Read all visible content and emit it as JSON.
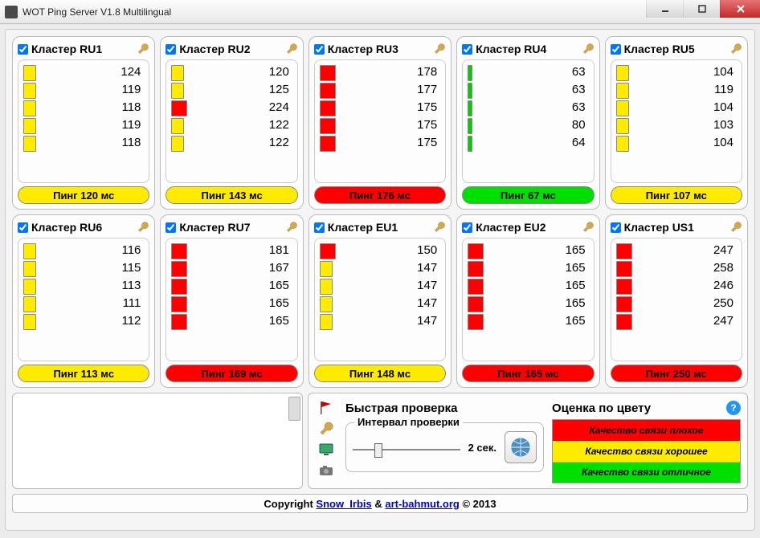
{
  "window": {
    "title": "WOT Ping Server V1.8 Multilingual"
  },
  "clusters": [
    {
      "name": "Кластер RU1",
      "checked": true,
      "pings": [
        124,
        119,
        118,
        119,
        118
      ],
      "levels": [
        "yellow",
        "yellow",
        "yellow",
        "yellow",
        "yellow"
      ],
      "summary": "Пинг 120 мс",
      "summary_level": "yellow"
    },
    {
      "name": "Кластер RU2",
      "checked": true,
      "pings": [
        120,
        125,
        224,
        122,
        122
      ],
      "levels": [
        "yellow",
        "yellow",
        "red",
        "yellow",
        "yellow"
      ],
      "summary": "Пинг 143 мс",
      "summary_level": "yellow"
    },
    {
      "name": "Кластер RU3",
      "checked": true,
      "pings": [
        178,
        177,
        175,
        175,
        175
      ],
      "levels": [
        "red",
        "red",
        "red",
        "red",
        "red"
      ],
      "summary": "Пинг 176 мс",
      "summary_level": "red"
    },
    {
      "name": "Кластер RU4",
      "checked": true,
      "pings": [
        63,
        63,
        63,
        80,
        64
      ],
      "levels": [
        "green",
        "green",
        "green",
        "green",
        "green"
      ],
      "summary": "Пинг 67 мс",
      "summary_level": "green"
    },
    {
      "name": "Кластер RU5",
      "checked": true,
      "pings": [
        104,
        119,
        104,
        103,
        104
      ],
      "levels": [
        "yellow",
        "yellow",
        "yellow",
        "yellow",
        "yellow"
      ],
      "summary": "Пинг 107 мс",
      "summary_level": "yellow"
    },
    {
      "name": "Кластер RU6",
      "checked": true,
      "pings": [
        116,
        115,
        113,
        111,
        112
      ],
      "levels": [
        "yellow",
        "yellow",
        "yellow",
        "yellow",
        "yellow"
      ],
      "summary": "Пинг 113 мс",
      "summary_level": "yellow"
    },
    {
      "name": "Кластер RU7",
      "checked": true,
      "pings": [
        181,
        167,
        165,
        165,
        165
      ],
      "levels": [
        "red",
        "red",
        "red",
        "red",
        "red"
      ],
      "summary": "Пинг 169 мс",
      "summary_level": "red"
    },
    {
      "name": "Кластер EU1",
      "checked": true,
      "pings": [
        150,
        147,
        147,
        147,
        147
      ],
      "levels": [
        "red",
        "yellow",
        "yellow",
        "yellow",
        "yellow"
      ],
      "summary": "Пинг 148 мс",
      "summary_level": "yellow"
    },
    {
      "name": "Кластер EU2",
      "checked": true,
      "pings": [
        165,
        165,
        165,
        165,
        165
      ],
      "levels": [
        "red",
        "red",
        "red",
        "red",
        "red"
      ],
      "summary": "Пинг 165 мс",
      "summary_level": "red"
    },
    {
      "name": "Кластер US1",
      "checked": true,
      "pings": [
        247,
        258,
        246,
        250,
        247
      ],
      "levels": [
        "red",
        "red",
        "red",
        "red",
        "red"
      ],
      "summary": "Пинг 250 мс",
      "summary_level": "red"
    }
  ],
  "controls": {
    "quick_check": "Быстрая проверка",
    "interval_label": "Интервал проверки",
    "interval_value": "2 сек."
  },
  "legend": {
    "title": "Оценка по цвету",
    "bad": "Качество связи плохое",
    "good": "Качество связи хорошее",
    "excellent": "Качество связи отличное"
  },
  "footer": {
    "prefix": "Copyright ",
    "link1": "Snow_Irbis",
    "amp": " & ",
    "link2": "art-bahmut.org",
    "suffix": " © 2013"
  }
}
